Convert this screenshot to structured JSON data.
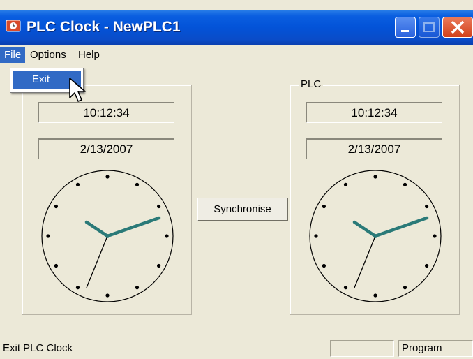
{
  "window": {
    "title": "PLC Clock - NewPLC1",
    "colors": {
      "titlebar": "#0353d8",
      "menu_highlight": "#316ac5",
      "clock_hands": "#2a7a78"
    }
  },
  "menubar": {
    "items": [
      {
        "label": "File"
      },
      {
        "label": "Options"
      },
      {
        "label": "Help"
      }
    ]
  },
  "file_menu": {
    "items": [
      {
        "label": "Exit"
      }
    ]
  },
  "left_panel": {
    "label": "",
    "time": "10:12:34",
    "date": "2/13/2007"
  },
  "right_panel": {
    "label": "PLC",
    "time": "10:12:34",
    "date": "2/13/2007"
  },
  "sync_button": {
    "label": "Synchronise"
  },
  "statusbar": {
    "text": "Exit PLC Clock",
    "mode": "Program"
  },
  "icons": [
    "app-icon",
    "minimize-icon",
    "maximize-icon",
    "close-icon",
    "pointer-cursor-icon"
  ]
}
